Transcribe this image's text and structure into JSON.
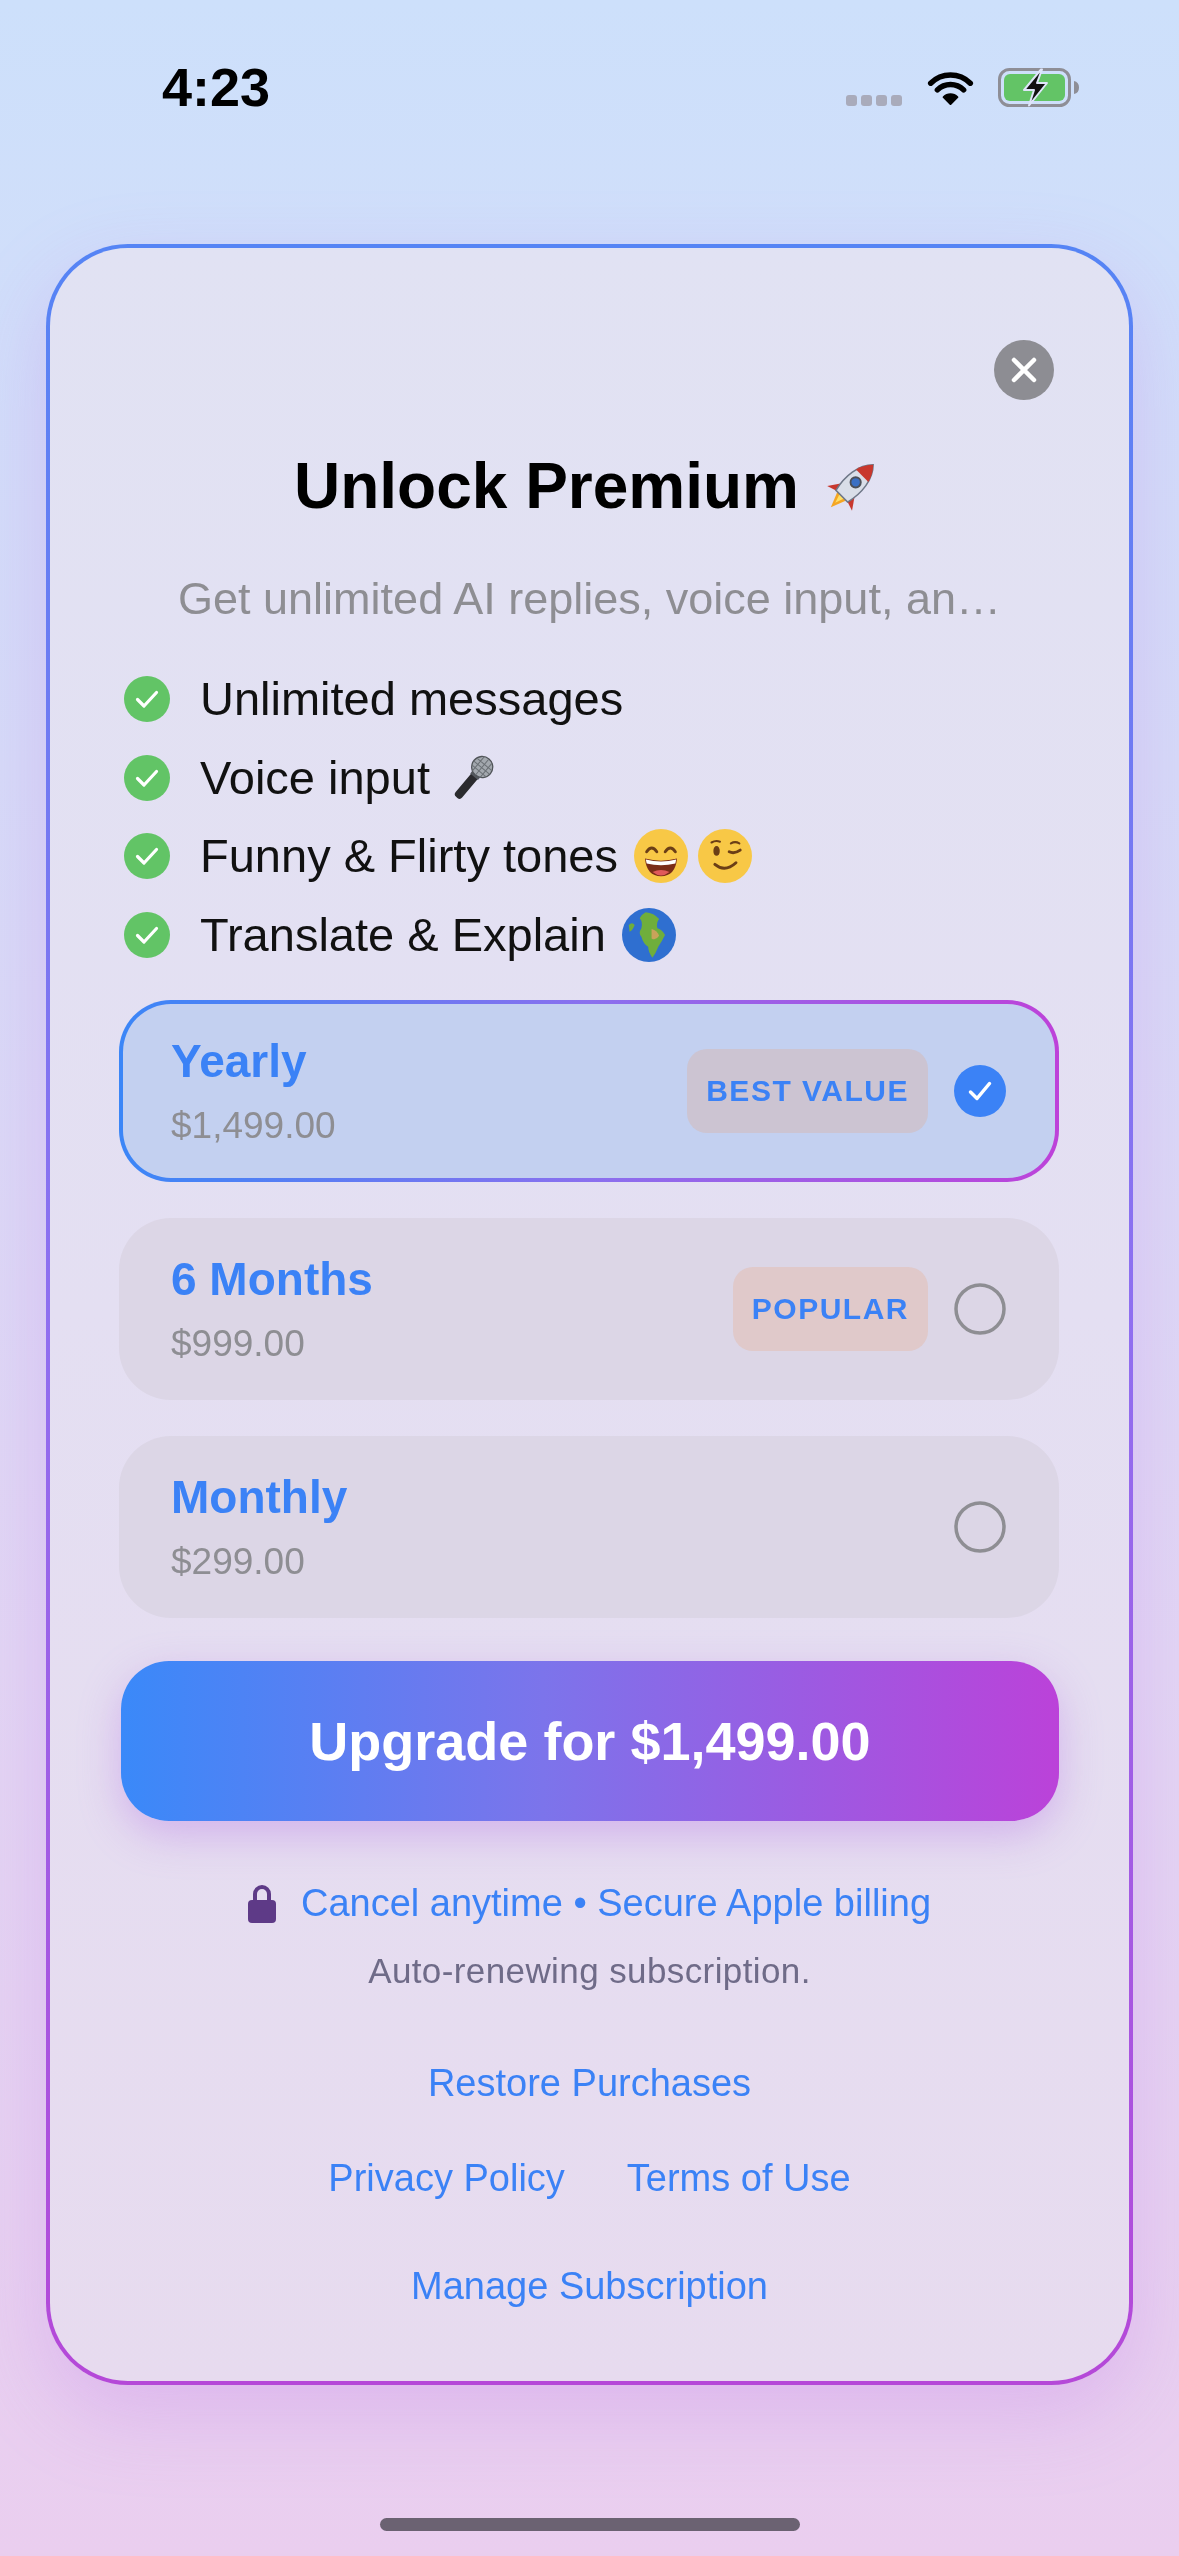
{
  "status_bar": {
    "time": "4:23"
  },
  "paywall": {
    "title": "Unlock Premium",
    "subtitle": "Get unlimited AI replies, voice input, an…",
    "features": [
      {
        "text": "Unlimited messages",
        "kind": "plain"
      },
      {
        "text": "Voice input",
        "kind": "voice"
      },
      {
        "text": "Funny & Flirty tones",
        "kind": "tones"
      },
      {
        "text": "Translate & Explain",
        "kind": "translate"
      }
    ],
    "plans": [
      {
        "name": "Yearly",
        "price": "$1,499.00",
        "badge": "BEST VALUE",
        "selected": true
      },
      {
        "name": "6 Months",
        "price": "$999.00",
        "badge": "POPULAR",
        "selected": false
      },
      {
        "name": "Monthly",
        "price": "$299.00",
        "selected": false
      }
    ],
    "upgrade_button": "Upgrade for $1,499.00",
    "assurance": "Cancel anytime • Secure Apple billing",
    "renewal_note": "Auto-renewing subscription.",
    "restore_link": "Restore Purchases",
    "legal_links": [
      "Privacy Policy",
      "Terms of Use"
    ],
    "manage_link": "Manage Subscription"
  }
}
